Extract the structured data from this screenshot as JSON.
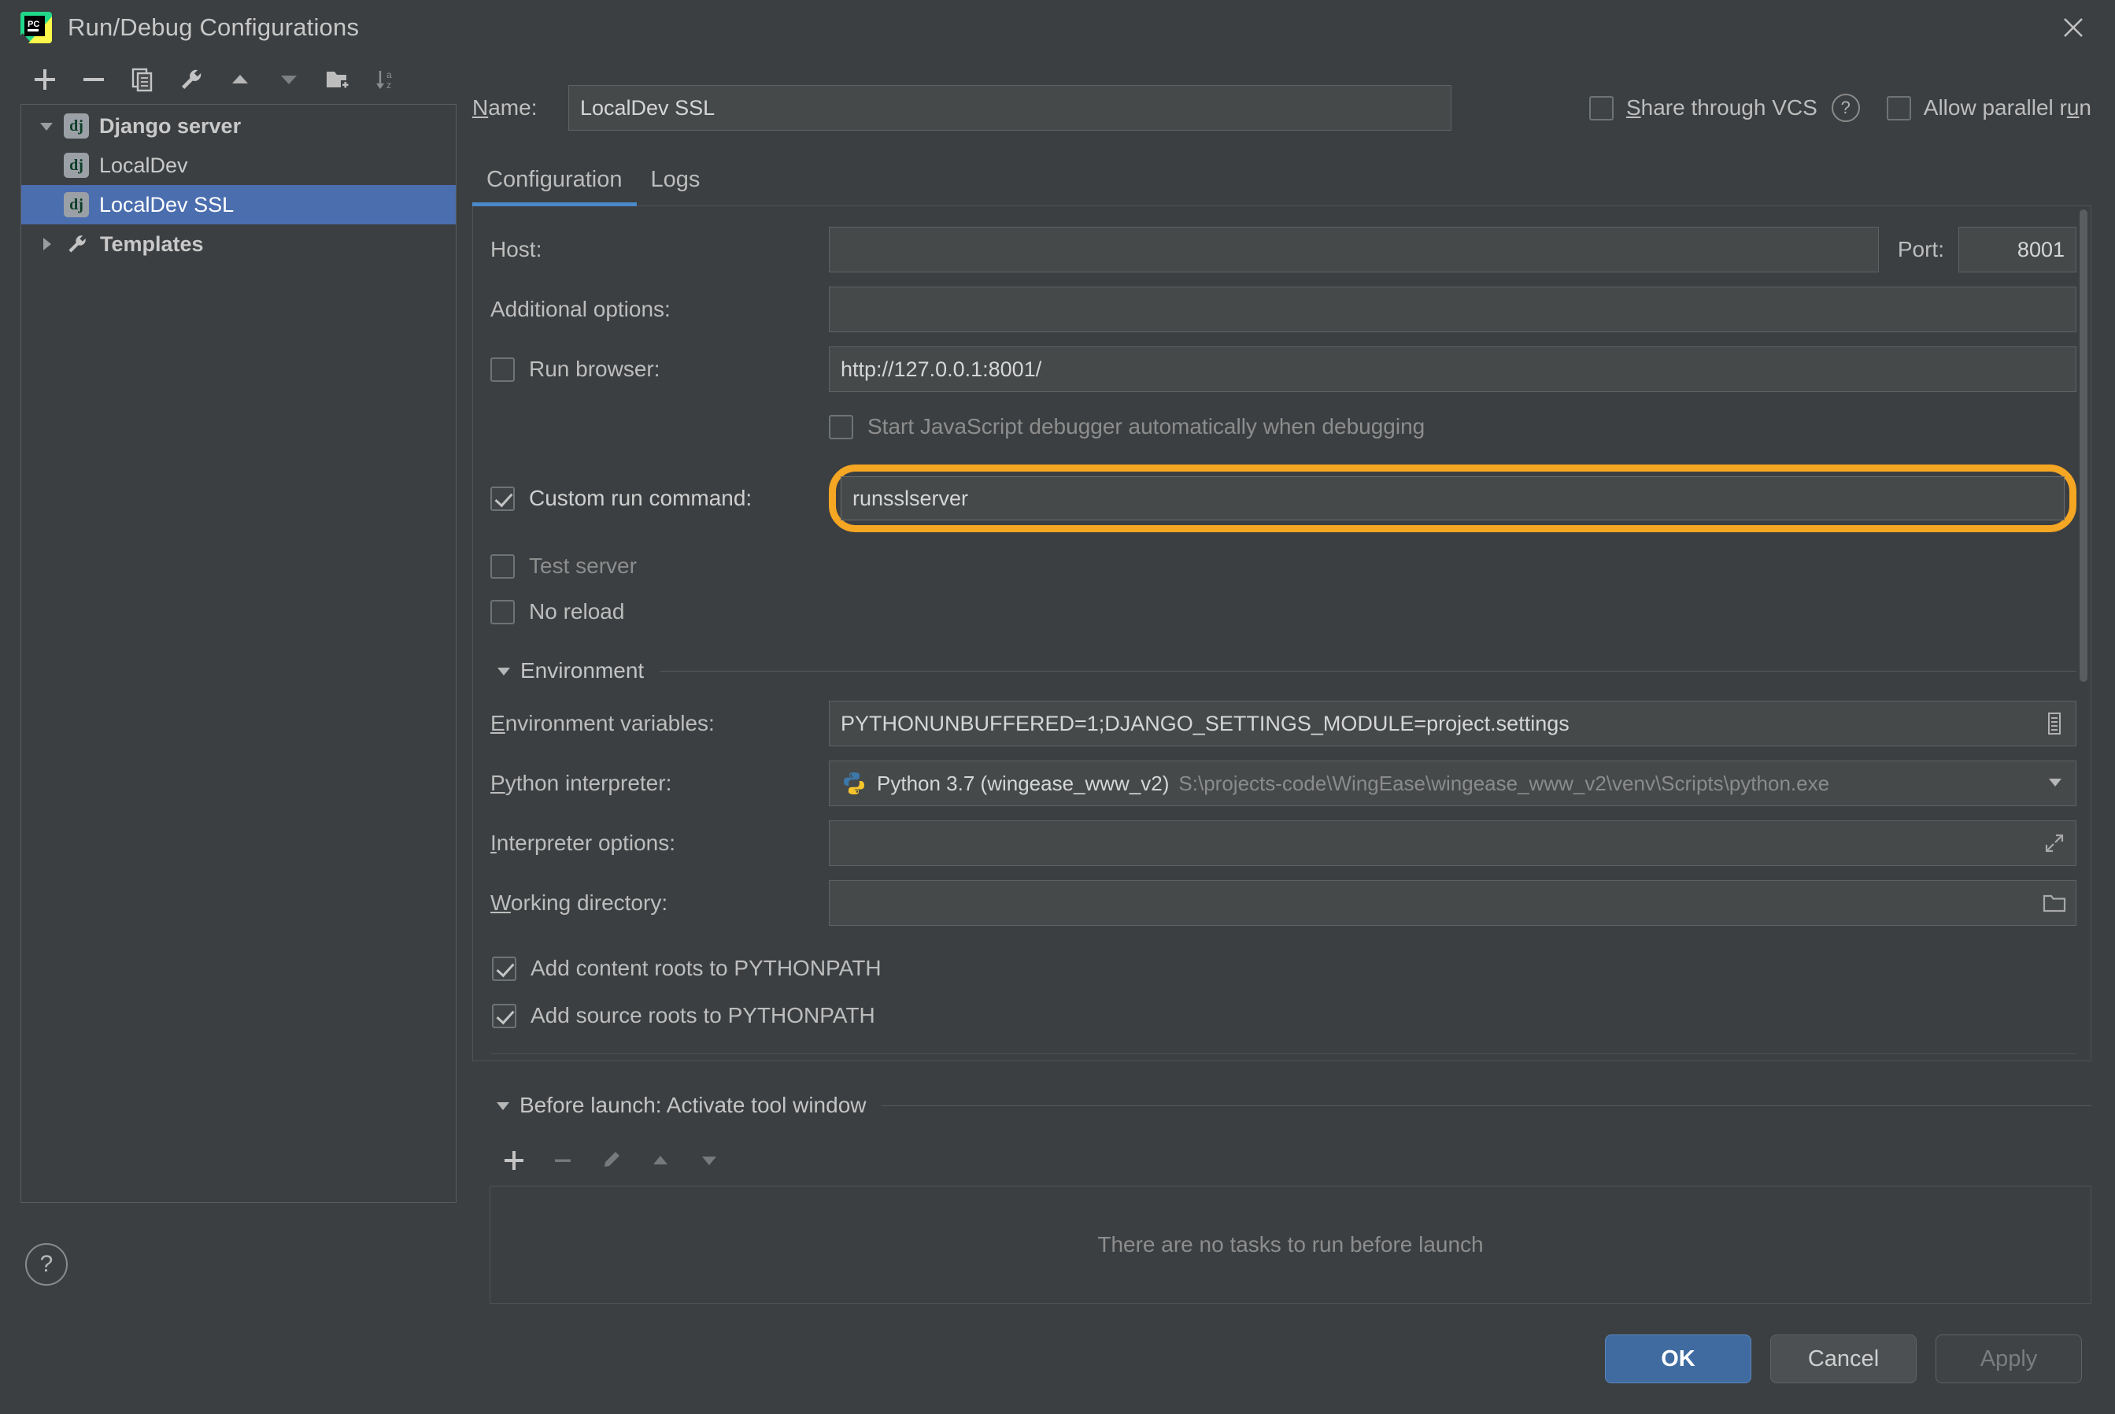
{
  "window": {
    "title": "Run/Debug Configurations",
    "app_icon": "pycharm-logo-icon",
    "close_icon": "close-icon"
  },
  "tree_toolbar": {
    "buttons": [
      {
        "name": "add-configuration-button",
        "icon": "plus-icon"
      },
      {
        "name": "remove-configuration-button",
        "icon": "minus-icon"
      },
      {
        "name": "copy-configuration-button",
        "icon": "copy-icon"
      },
      {
        "name": "edit-templates-button",
        "icon": "wrench-icon"
      },
      {
        "name": "move-up-button",
        "icon": "arrow-up-icon"
      },
      {
        "name": "move-down-button",
        "icon": "arrow-down-icon"
      },
      {
        "name": "new-folder-button",
        "icon": "folder-add-icon"
      },
      {
        "name": "sort-configurations-button",
        "icon": "sort-az-icon"
      }
    ]
  },
  "tree": {
    "items": [
      {
        "label": "Django server",
        "icon": "django-icon",
        "level": 0,
        "expanded": true,
        "selected": false,
        "bold": true,
        "twisty": "chevron-down-icon"
      },
      {
        "label": "LocalDev",
        "icon": "django-icon",
        "level": 1,
        "selected": false,
        "bold": false
      },
      {
        "label": "LocalDev SSL",
        "icon": "django-icon",
        "level": 1,
        "selected": true,
        "bold": false
      },
      {
        "label": "Templates",
        "icon": "wrench-icon",
        "level": 0,
        "expanded": false,
        "selected": false,
        "bold": true,
        "twisty": "chevron-right-icon"
      }
    ]
  },
  "help_button": {
    "name": "help-button",
    "glyph": "?"
  },
  "header": {
    "name_label": "Name:",
    "name_value": "LocalDev SSL",
    "share_vcs_label": "Share through VCS",
    "share_vcs_checked": false,
    "share_vcs_help_glyph": "?",
    "allow_parallel_label": "Allow parallel run",
    "allow_parallel_checked": false
  },
  "tabs": [
    {
      "label": "Configuration",
      "active": true
    },
    {
      "label": "Logs",
      "active": false
    }
  ],
  "config": {
    "host_label": "Host:",
    "host_value": "",
    "port_label": "Port:",
    "port_value": "8001",
    "additional_options_label": "Additional options:",
    "additional_options_value": "",
    "run_browser_label": "Run browser:",
    "run_browser_checked": false,
    "run_browser_url": "http://127.0.0.1:8001/",
    "js_debugger_label": "Start JavaScript debugger automatically when debugging",
    "js_debugger_checked": false,
    "custom_run_command_label": "Custom run command:",
    "custom_run_command_checked": true,
    "custom_run_command_value": "runsslserver",
    "custom_run_command_highlight_color": "#f5a623",
    "test_server_label": "Test server",
    "test_server_checked": false,
    "no_reload_label": "No reload",
    "no_reload_checked": false,
    "environment_section_label": "Environment",
    "env_vars_label": "Environment variables:",
    "env_vars_value": "PYTHONUNBUFFERED=1;DJANGO_SETTINGS_MODULE=project.settings",
    "env_vars_browse_icon": "list-edit-icon",
    "python_interpreter_label": "Python interpreter:",
    "python_interpreter_name": "Python 3.7 (wingease_www_v2)",
    "python_interpreter_path": "S:\\projects-code\\WingEase\\wingease_www_v2\\venv\\Scripts\\python.exe",
    "python_interpreter_icon": "python-icon",
    "python_interpreter_caret": "chevron-down-icon",
    "interpreter_options_label": "Interpreter options:",
    "interpreter_options_value": "",
    "interpreter_options_icon": "expand-icon",
    "working_directory_label": "Working directory:",
    "working_directory_value": "",
    "working_directory_icon": "folder-icon",
    "add_content_roots_label": "Add content roots to PYTHONPATH",
    "add_content_roots_checked": true,
    "add_source_roots_label": "Add source roots to PYTHONPATH",
    "add_source_roots_checked": true
  },
  "before_launch": {
    "section_label": "Before launch: Activate tool window",
    "toolbar": [
      {
        "name": "add-task-button",
        "icon": "plus-icon"
      },
      {
        "name": "remove-task-button",
        "icon": "minus-icon"
      },
      {
        "name": "edit-task-button",
        "icon": "pencil-icon"
      },
      {
        "name": "task-move-up-button",
        "icon": "arrow-up-icon"
      },
      {
        "name": "task-move-down-button",
        "icon": "arrow-down-icon"
      }
    ],
    "empty_text": "There are no tasks to run before launch"
  },
  "footer": {
    "ok_label": "OK",
    "cancel_label": "Cancel",
    "apply_label": "Apply",
    "apply_disabled": true
  },
  "colors": {
    "background": "#3c3f41",
    "selection_blue": "#4b6eaf",
    "accent_tab": "#4a88c7",
    "highlight_orange": "#f5a623",
    "primary_button": "#3f6ba0"
  }
}
